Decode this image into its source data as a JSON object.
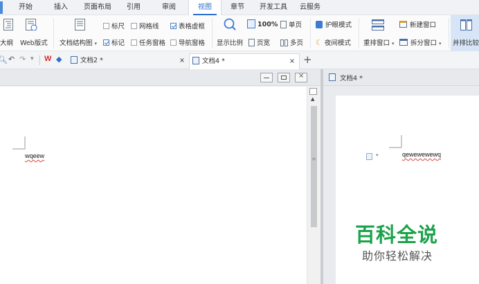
{
  "menu": {
    "tabs": [
      {
        "label": "开始"
      },
      {
        "label": "插入"
      },
      {
        "label": "页面布局"
      },
      {
        "label": "引用"
      },
      {
        "label": "审阅"
      },
      {
        "label": "视图"
      },
      {
        "label": "章节"
      },
      {
        "label": "开发工具"
      },
      {
        "label": "云服务"
      }
    ],
    "active_tab": "视图"
  },
  "ribbon": {
    "outline": "大纲",
    "web_layout": "Web版式",
    "doc_structure": "文档结构图",
    "ruler": "标尺",
    "gridlines": "网格线",
    "table_gridlines": "表格虚框",
    "marks": "标记",
    "task_pane": "任务窗格",
    "nav_pane": "导航窗格",
    "ruler_checked": false,
    "gridlines_checked": false,
    "table_gridlines_checked": true,
    "marks_checked": true,
    "task_pane_checked": false,
    "nav_pane_checked": false,
    "zoom": "显示比例",
    "zoom_100": "100%",
    "page_width": "页宽",
    "one_page": "单页",
    "multi_page": "多页",
    "eye_mode": "护眼模式",
    "night_mode": "夜间模式",
    "arrange_window": "重排窗口",
    "new_window": "新建窗口",
    "split_window": "拆分窗口",
    "side_by_side": "并排比较",
    "accent_color": "#2a6fd0"
  },
  "doc_tabs": {
    "tab1": "文档2 *",
    "tab2": "文档4 *",
    "close": "×",
    "add": "+"
  },
  "left_pane": {
    "text": "wqeew"
  },
  "right_pane": {
    "title": "文档4 *",
    "text": "qewewewewq"
  },
  "watermark": {
    "title": "百科全说",
    "subtitle": "助你轻松解决",
    "color": "#1aa34a"
  }
}
